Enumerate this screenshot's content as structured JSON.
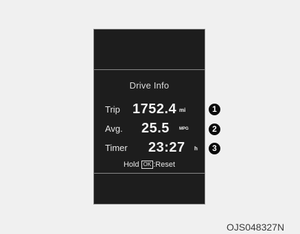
{
  "display": {
    "title": "Drive Info",
    "trip": {
      "label": "Trip",
      "value": "1752.4",
      "unit": "mi"
    },
    "avg": {
      "label": "Avg.",
      "value": "25.5",
      "unit": "MPG"
    },
    "timer": {
      "label": "Timer",
      "value": "23:27",
      "unit": "h"
    },
    "hold": {
      "prefix": "Hold",
      "key": "OK",
      "suffix": ":Reset"
    }
  },
  "callouts": [
    "1",
    "2",
    "3"
  ],
  "figure_code": "OJS048327N"
}
